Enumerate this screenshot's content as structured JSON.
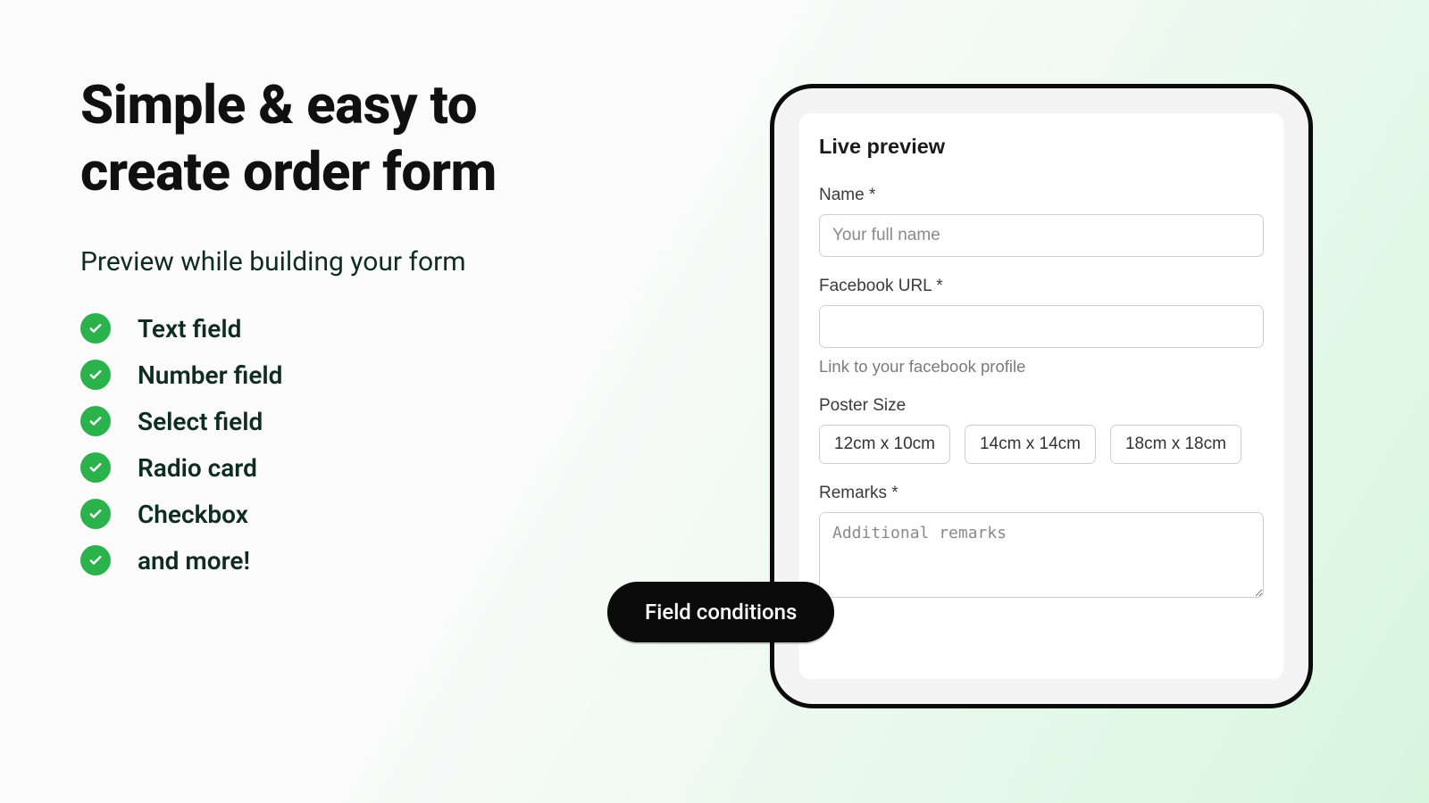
{
  "left": {
    "heading": "Simple & easy to create order form",
    "subheading": "Preview while building your form",
    "features": [
      "Text field",
      "Number field",
      "Select field",
      "Radio card",
      "Checkbox",
      "and more!"
    ]
  },
  "preview": {
    "title": "Live preview",
    "name": {
      "label": "Name *",
      "placeholder": "Your full name"
    },
    "facebook": {
      "label": "Facebook URL *",
      "help": "Link to your facebook profile"
    },
    "poster": {
      "label": "Poster Size",
      "options": [
        "12cm x 10cm",
        "14cm x 14cm",
        "18cm x 18cm"
      ]
    },
    "remarks": {
      "label": "Remarks *",
      "placeholder": "Additional remarks"
    }
  },
  "pill": {
    "label": "Field conditions"
  }
}
